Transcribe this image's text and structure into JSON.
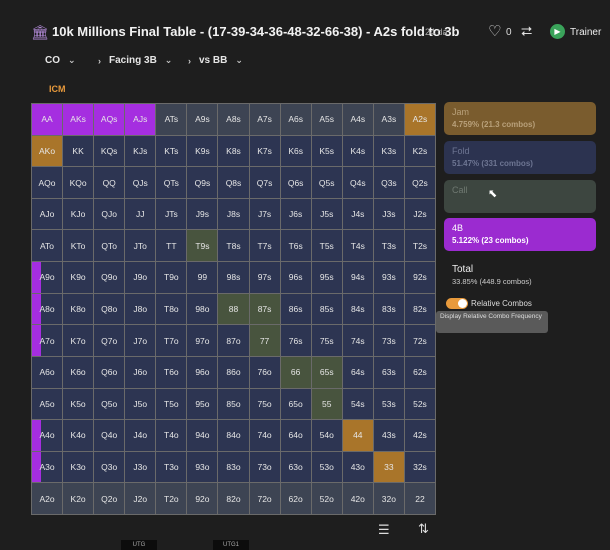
{
  "header": {
    "title": "10k Millions Final Table - (17-39-34-36-48-32-66-38) - A2s fold to 3b",
    "title_suffix": "24 da",
    "title_icon": "building-icon",
    "likes": "0",
    "trainer_label": "Trainer"
  },
  "breadcrumb": {
    "position": "CO",
    "facing": "Facing 3B",
    "vs": "vs BB"
  },
  "icm_label": "ICM",
  "colors": {
    "jam": "#e89a3c",
    "fold": "#3c4670",
    "call": "#5b6a56",
    "four_bet": "#a52ee0",
    "fold_cell": "#2d3552",
    "call_cell": "#48543e",
    "jam_cell": "#a9752a"
  },
  "legend": {
    "jam": {
      "name": "Jam",
      "value": "4.759% (21.3 combos)"
    },
    "fold": {
      "name": "Fold",
      "value": "51.47% (331 combos)"
    },
    "call": {
      "name": "Call",
      "value": ""
    },
    "four_bet": {
      "name": "4B",
      "value": "5.122% (23 combos)"
    }
  },
  "total": {
    "label": "Total",
    "value": "33.85% (448.9 combos)"
  },
  "relative_combos": {
    "label": "Relative Combos",
    "checked": true,
    "tooltip": "Display Relative Combo Frequency"
  },
  "positions": [
    "UTG",
    "UTG1"
  ],
  "grid": {
    "rows": [
      [
        "AA",
        "AKs",
        "AQs",
        "AJs",
        "ATs",
        "A9s",
        "A8s",
        "A7s",
        "A6s",
        "A5s",
        "A4s",
        "A3s",
        "A2s"
      ],
      [
        "AKo",
        "KK",
        "KQs",
        "KJs",
        "KTs",
        "K9s",
        "K8s",
        "K7s",
        "K6s",
        "K5s",
        "K4s",
        "K3s",
        "K2s"
      ],
      [
        "AQo",
        "KQo",
        "QQ",
        "QJs",
        "QTs",
        "Q9s",
        "Q8s",
        "Q7s",
        "Q6s",
        "Q5s",
        "Q4s",
        "Q3s",
        "Q2s"
      ],
      [
        "AJo",
        "KJo",
        "QJo",
        "JJ",
        "JTs",
        "J9s",
        "J8s",
        "J7s",
        "J6s",
        "J5s",
        "J4s",
        "J3s",
        "J2s"
      ],
      [
        "ATo",
        "KTo",
        "QTo",
        "JTo",
        "TT",
        "T9s",
        "T8s",
        "T7s",
        "T6s",
        "T5s",
        "T4s",
        "T3s",
        "T2s"
      ],
      [
        "A9o",
        "K9o",
        "Q9o",
        "J9o",
        "T9o",
        "99",
        "98s",
        "97s",
        "96s",
        "95s",
        "94s",
        "93s",
        "92s"
      ],
      [
        "A8o",
        "K8o",
        "Q8o",
        "J8o",
        "T8o",
        "98o",
        "88",
        "87s",
        "86s",
        "85s",
        "84s",
        "83s",
        "82s"
      ],
      [
        "A7o",
        "K7o",
        "Q7o",
        "J7o",
        "T7o",
        "97o",
        "87o",
        "77",
        "76s",
        "75s",
        "74s",
        "73s",
        "72s"
      ],
      [
        "A6o",
        "K6o",
        "Q6o",
        "J6o",
        "T6o",
        "96o",
        "86o",
        "76o",
        "66",
        "65s",
        "64s",
        "63s",
        "62s"
      ],
      [
        "A5o",
        "K5o",
        "Q5o",
        "J5o",
        "T5o",
        "95o",
        "85o",
        "75o",
        "65o",
        "55",
        "54s",
        "53s",
        "52s"
      ],
      [
        "A4o",
        "K4o",
        "Q4o",
        "J4o",
        "T4o",
        "94o",
        "84o",
        "74o",
        "64o",
        "54o",
        "44",
        "43s",
        "42s"
      ],
      [
        "A3o",
        "K3o",
        "Q3o",
        "J3o",
        "T3o",
        "93o",
        "83o",
        "73o",
        "63o",
        "53o",
        "43o",
        "33",
        "32s"
      ],
      [
        "A2o",
        "K2o",
        "Q2o",
        "J2o",
        "T2o",
        "92o",
        "82o",
        "72o",
        "62o",
        "52o",
        "42o",
        "32o",
        "22"
      ]
    ],
    "action_codes": [
      "4444FFFFFFFFJ4",
      "JCCCCCCCCCCCC",
      "CCCCCCCCCCCCC",
      "CCCCCCCCCCCCC",
      "CCCCCPCCCCCCC",
      "4CCCCCCCCCCCC",
      "4CCCCCPPCCCCC",
      "4CCCCCCPCCCCC",
      "CCCCCCCCPPCCC",
      "CCCCCCCCCPCCC",
      "4CCCCCCCCCJCC",
      "4CCCCCCCCCCJC",
      "FFFFFFFFFFFFF"
    ]
  }
}
